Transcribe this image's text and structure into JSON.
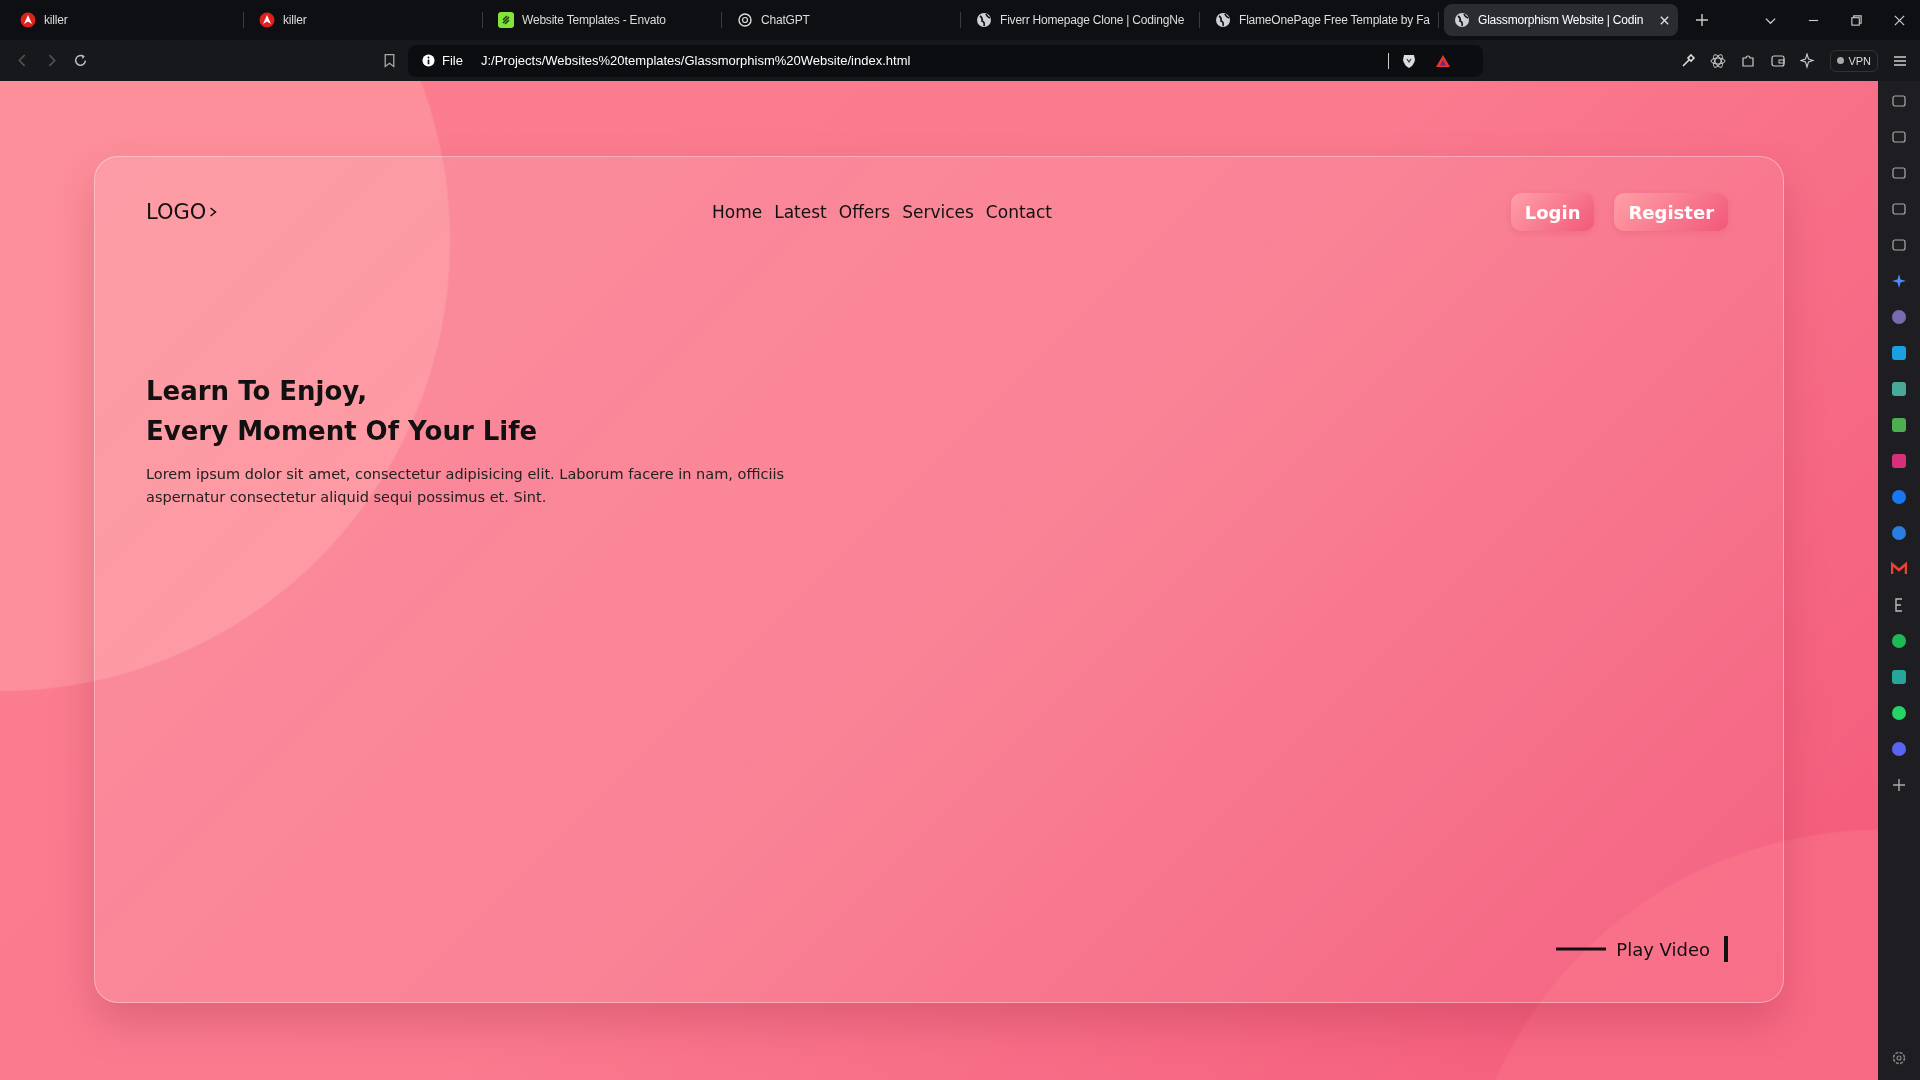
{
  "browser": {
    "tabs": [
      {
        "title": "killer",
        "kind": "brave",
        "selected": false
      },
      {
        "title": "killer",
        "kind": "brave",
        "selected": false
      },
      {
        "title": "Website Templates - Envato",
        "kind": "envato",
        "selected": false
      },
      {
        "title": "ChatGPT",
        "kind": "openai",
        "selected": false
      },
      {
        "title": "Fiverr Homepage Clone | CodingNe",
        "kind": "globe",
        "selected": false
      },
      {
        "title": "FlameOnePage Free Template by Fa",
        "kind": "globe",
        "selected": false
      },
      {
        "title": "Glassmorphism Website | Codin",
        "kind": "globe",
        "selected": true
      }
    ],
    "address": {
      "scheme": "File",
      "url": "J:/Projects/Websites%20templates/Glassmorphism%20Website/index.html"
    },
    "vpn": "VPN"
  },
  "page": {
    "logo": "LOGO",
    "nav": [
      "Home",
      "Latest",
      "Offers",
      "Services",
      "Contact"
    ],
    "buttons": [
      "Login",
      "Register"
    ],
    "heading": [
      "Learn To Enjoy,",
      "Every Moment Of Your Life"
    ],
    "paragraph": "Lorem ipsum dolor sit amet, consectetur adipisicing elit. Laborum facere in nam, officiis aspernatur consectetur aliquid sequi possimus et. Sint.",
    "play_video": "Play Video"
  }
}
